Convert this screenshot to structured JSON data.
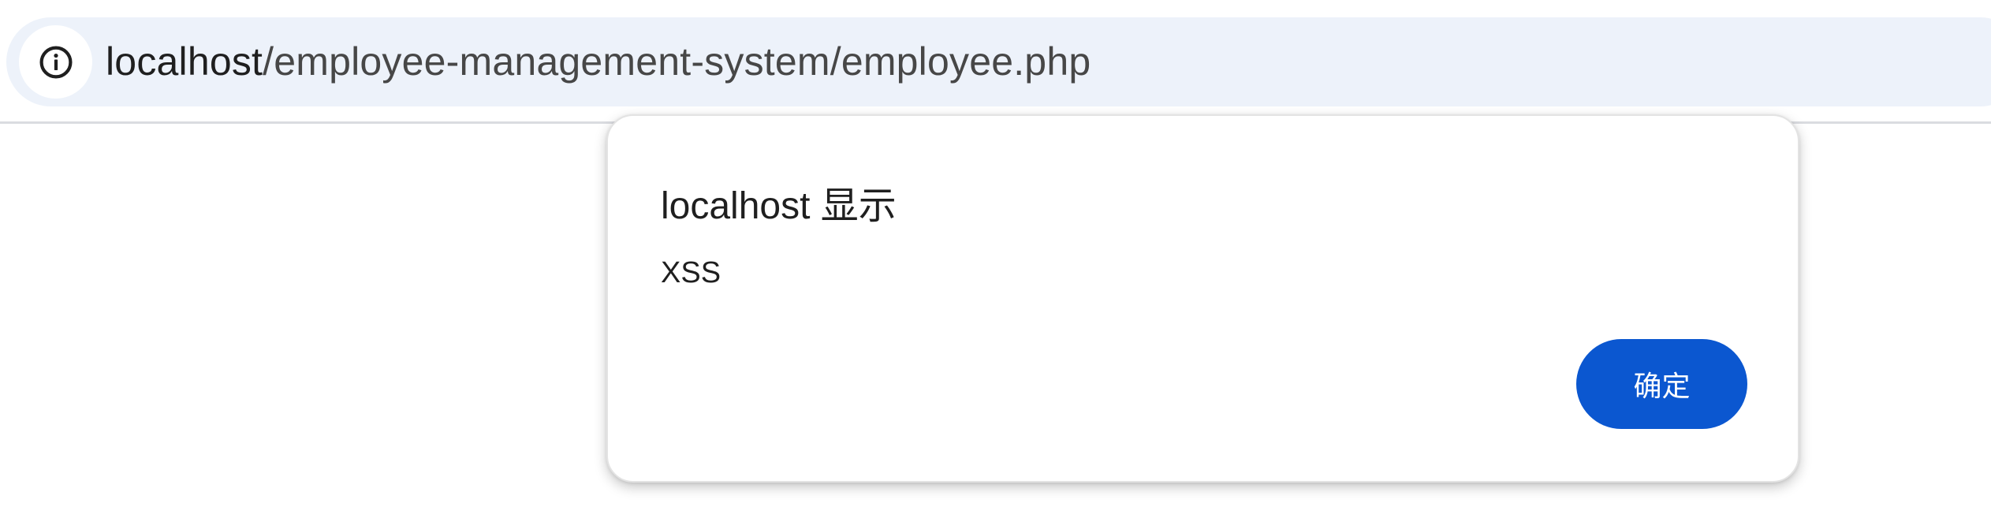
{
  "address_bar": {
    "host": "localhost",
    "path": "/employee-management-system/employee.php",
    "site_info_icon": "info-icon"
  },
  "dialog": {
    "title": "localhost 显示",
    "message": "XSS",
    "ok_label": "确定"
  },
  "colors": {
    "omnibox_bg": "#edf2fa",
    "accent": "#0b57d0",
    "text": "#1f1f1f"
  }
}
